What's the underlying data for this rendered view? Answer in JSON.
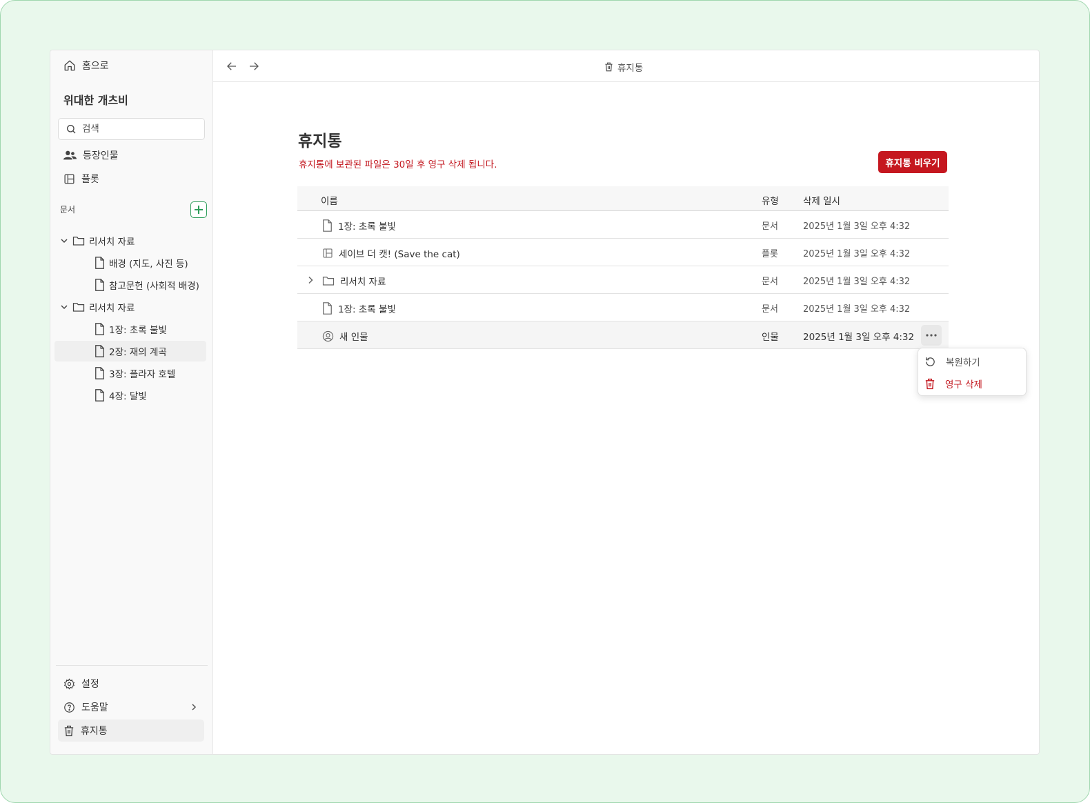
{
  "sidebar": {
    "home_label": "홈으로",
    "project_title": "위대한 개츠비",
    "search_placeholder": "검색",
    "characters_label": "등장인물",
    "plot_label": "플롯",
    "docs_label": "문서",
    "tree": [
      {
        "label": "리서치 자료",
        "kind": "folder"
      },
      {
        "label": "배경 (지도, 사진 등)",
        "kind": "doc"
      },
      {
        "label": "참고문헌 (사회적 배경)",
        "kind": "doc"
      },
      {
        "label": "리서치 자료",
        "kind": "folder"
      },
      {
        "label": "1장: 초록 불빛",
        "kind": "doc"
      },
      {
        "label": "2장: 재의 계곡",
        "kind": "doc"
      },
      {
        "label": "3장: 플라자 호텔",
        "kind": "doc"
      },
      {
        "label": "4장: 달빛",
        "kind": "doc"
      }
    ],
    "settings_label": "설정",
    "help_label": "도움말",
    "trash_label": "휴지통"
  },
  "topbar": {
    "breadcrumb": "휴지통"
  },
  "main": {
    "title": "휴지통",
    "notice": "휴지통에 보관된 파일은 30일 후 영구 삭제 됩니다.",
    "empty_button": "휴지통 비우기",
    "columns": {
      "name": "이름",
      "type": "유형",
      "date": "삭제 일시"
    },
    "rows": [
      {
        "name": "1장: 초록 불빛",
        "type": "문서",
        "date": "2025년 1월 3일 오후 4:32",
        "icon": "document-icon"
      },
      {
        "name": "세이브 더 캣! (Save the cat)",
        "type": "플롯",
        "date": "2025년 1월 3일 오후 4:32",
        "icon": "layout-icon"
      },
      {
        "name": "리서치 자료",
        "type": "문서",
        "date": "2025년 1월 3일 오후 4:32",
        "icon": "folder-icon"
      },
      {
        "name": "1장: 초록 불빛",
        "type": "문서",
        "date": "2025년 1월 3일 오후 4:32",
        "icon": "document-icon"
      },
      {
        "name": "새 인물",
        "type": "인물",
        "date": "2025년 1월 3일 오후 4:32",
        "icon": "person-icon"
      }
    ]
  },
  "context_menu": {
    "restore_label": "복원하기",
    "delete_label": "영구 삭제"
  },
  "colors": {
    "danger": "#c5171f",
    "accent_green": "#2e9d5a",
    "frame_bg": "#e9f8ec"
  }
}
